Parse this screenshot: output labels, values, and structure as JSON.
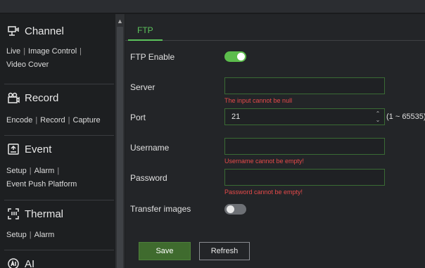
{
  "sidebar": {
    "sections": [
      {
        "title": "Channel",
        "icon": "channel-icon",
        "links": [
          "Live",
          "Image Control",
          "Video Cover"
        ]
      },
      {
        "title": "Record",
        "icon": "record-icon",
        "links": [
          "Encode",
          "Record",
          "Capture"
        ]
      },
      {
        "title": "Event",
        "icon": "event-icon",
        "links": [
          "Setup",
          "Alarm",
          "Event Push Platform"
        ]
      },
      {
        "title": "Thermal",
        "icon": "thermal-icon",
        "links": [
          "Setup",
          "Alarm"
        ]
      },
      {
        "title": "AI",
        "icon": "ai-icon",
        "links": []
      }
    ]
  },
  "tab": {
    "label": "FTP"
  },
  "form": {
    "ftp_enable": {
      "label": "FTP Enable",
      "enabled": true
    },
    "server": {
      "label": "Server",
      "value": "",
      "error": "The input cannot be null"
    },
    "port": {
      "label": "Port",
      "value": "21",
      "range": "(1 ~ 65535)"
    },
    "username": {
      "label": "Username",
      "value": "",
      "error": "Username cannot be empty!"
    },
    "password": {
      "label": "Password",
      "value": "",
      "error": "Password cannot be empty!"
    },
    "transfer_images": {
      "label": "Transfer images",
      "enabled": false
    }
  },
  "buttons": {
    "save": "Save",
    "refresh": "Refresh"
  },
  "colors": {
    "accent": "#5cc35c",
    "error": "#e64a4a",
    "toggle_on": "#5cbd4c",
    "save_bg": "#3f6b2e"
  }
}
